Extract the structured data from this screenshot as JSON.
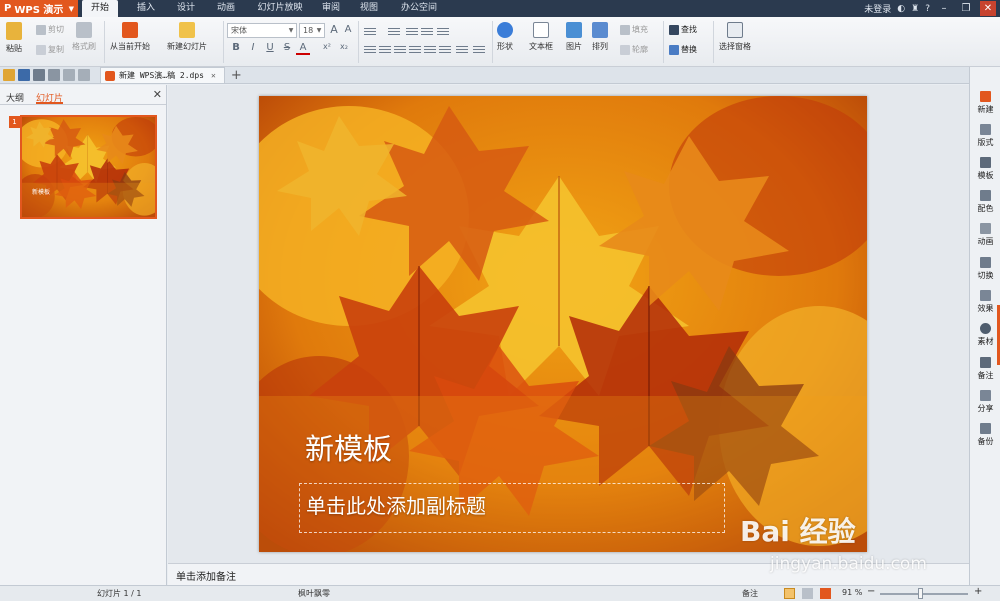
{
  "app": {
    "name": "WPS 演示",
    "accent": "#e2571e"
  },
  "menu": {
    "tabs": [
      "开始",
      "插入",
      "设计",
      "动画",
      "幻灯片放映",
      "审阅",
      "视图",
      "办公空间"
    ],
    "active_tab": "开始",
    "login": "未登录",
    "help": "?"
  },
  "ribbon": {
    "paste": "粘贴",
    "cut": "剪切",
    "copy": "复制",
    "format_painter": "格式刷",
    "from_current": "从当前开始",
    "new_slide": "新建幻灯片",
    "font_name": "宋体",
    "font_size": "18",
    "bold": "B",
    "italic": "I",
    "underline": "U",
    "strike": "S",
    "shape": "形状",
    "textbox": "文本框",
    "picture": "图片",
    "arrange": "排列",
    "fill": "填充",
    "outline": "轮廓",
    "find": "查找",
    "replace": "替换",
    "select_pane": "选择窗格"
  },
  "document": {
    "tab_title": "新建 WPS演…稿 2.dps"
  },
  "left_panel": {
    "tab_outline": "大纲",
    "tab_slides": "幻灯片",
    "slide_number": "1",
    "thumb_title": "新模板"
  },
  "slide": {
    "title": "新模板",
    "subtitle_placeholder": "单击此处添加副标题"
  },
  "notes": {
    "placeholder": "单击添加备注"
  },
  "right_bar": {
    "items": [
      "新建",
      "版式",
      "模板",
      "配色",
      "动画",
      "切换",
      "效果",
      "素材",
      "备注",
      "分享",
      "备份"
    ]
  },
  "status": {
    "slide_info": "幻灯片 1 / 1",
    "theme": "枫叶飘零",
    "notes_btn": "备注",
    "zoom": "91 %",
    "zoom_minus": "−",
    "zoom_plus": "+"
  },
  "watermark": {
    "text": "Bai 经验",
    "url": "jingyan.baidu.com"
  }
}
